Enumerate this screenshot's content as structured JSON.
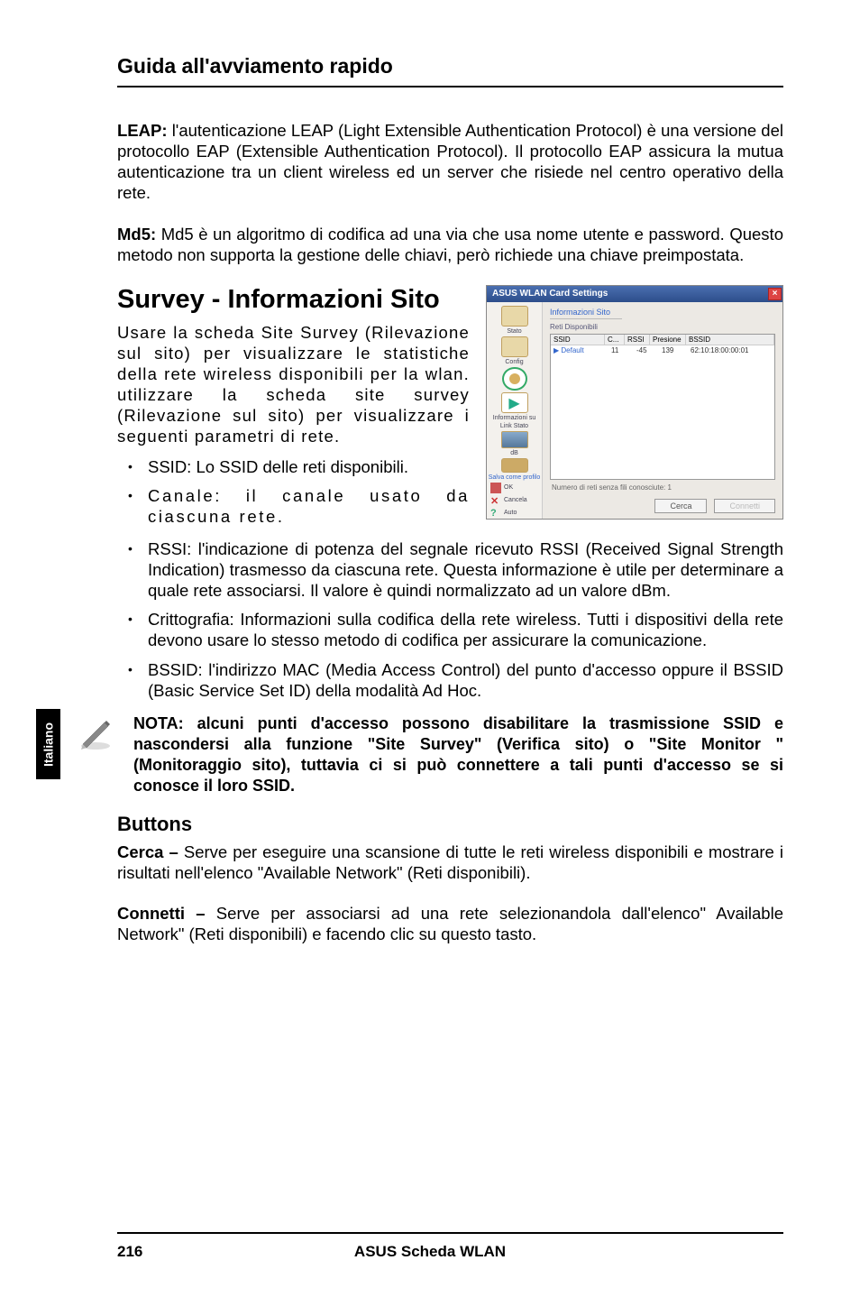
{
  "header": {
    "title": "Guida all'avviamento rapido"
  },
  "paragraphs": {
    "leap": {
      "bold": "LEAP:",
      "text": " l'autenticazione LEAP (Light Extensible Authentication Protocol) è una versione del protocollo EAP (Extensible Authentication Protocol). Il protocollo EAP assicura la mutua autenticazione tra un client wireless ed un server che risiede nel centro operativo della rete."
    },
    "md5": {
      "bold": "Md5:",
      "text": " Md5 è un algoritmo di codifica ad una via che usa nome utente e password. Questo metodo non supporta la gestione delle chiavi, però richiede una chiave preimpostata."
    }
  },
  "section": {
    "title": "Survey - Informazioni Sito",
    "intro": "Usare la scheda Site Survey (Rilevazione sul sito) per visualizzare le statistiche della rete wireless disponibili per la wlan. utilizzare la scheda site survey (Rilevazione sul sito) per visualizzare i seguenti parametri di rete."
  },
  "bullets_left": {
    "ssid": {
      "bold": "SSID:",
      "text": " Lo SSID delle reti disponibili."
    },
    "canale": {
      "bold": "Canale:",
      "text": " il canale usato da ciascuna rete."
    }
  },
  "bullets_full": {
    "rssi": {
      "bold": "RSSI:",
      "text": " l'indicazione di potenza del segnale ricevuto RSSI (Received Signal Strength Indication) trasmesso da ciascuna rete. Questa informazione è utile per determinare a quale rete associarsi. Il valore è quindi normalizzato ad un valore dBm."
    },
    "critto": {
      "bold": "Crittografia:",
      "text": " Informazioni sulla codifica della rete wireless. Tutti i dispositivi della rete devono usare lo stesso metodo di codifica per assicurare la comunicazione."
    },
    "bssid": {
      "bold": "BSSID:",
      "text": " l'indirizzo MAC (Media Access Control) del punto d'accesso oppure il BSSID (Basic Service Set ID) della modalità Ad Hoc."
    }
  },
  "note": "NOTA: alcuni punti d'accesso possono disabilitare la trasmissione SSID e nascondersi alla funzione \"Site Survey\" (Verifica sito) o \"Site Monitor \" (Monitoraggio sito), tuttavia ci si può connettere a tali punti d'accesso se si conosce il loro SSID.",
  "buttons_section": {
    "heading": "Buttons",
    "cerca": {
      "bold": "Cerca –",
      "text": " Serve per eseguire una scansione di tutte le reti wireless disponibili e mostrare i risultati nell'elenco \"Available Network\" (Reti disponibili)."
    },
    "connetti": {
      "bold": "Connetti –",
      "text": " Serve per associarsi ad una rete selezionandola dall'elenco\" Available Network\" (Reti disponibili) e facendo clic su questo tasto."
    }
  },
  "sidebar_tab": "Italiano",
  "footer": {
    "page": "216",
    "center": "ASUS Scheda WLAN"
  },
  "screenshot": {
    "title": "ASUS WLAN Card Settings",
    "tab1": "Informazioni Sito",
    "tab2": "Reti Disponibili",
    "th_ssid": "SSID",
    "th_c": "C...",
    "th_rssi": "RSSI",
    "th_pres": "Presione",
    "th_bssid": "BSSID",
    "row_ssid": "Default",
    "row_c": "11",
    "row_r1": "-45",
    "row_r2": "139",
    "row_bssid": "62:10:18:00:00:01",
    "status": "Numero di reti senza fili conosciute: 1",
    "btn_cerca": "Cerca",
    "btn_conn": "Connetti",
    "side_stato": "Stato",
    "side_config": "Config",
    "side_info": "Informazioni su",
    "side_link": "Link Stato",
    "side_db": "dB",
    "side_save": "Salva come profilo",
    "side_ok": "OK",
    "side_cancel": "Cancela",
    "side_auto": "Auto"
  }
}
